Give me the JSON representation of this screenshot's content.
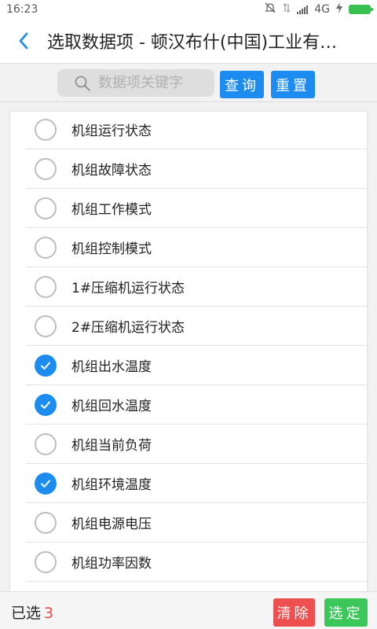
{
  "status_bar": {
    "time": "16:23",
    "network": "4G"
  },
  "header": {
    "title": "选取数据项 - 顿汉布什(中国)工业有…"
  },
  "search": {
    "placeholder": "数据项关键字",
    "query_label": "查询",
    "reset_label": "重置"
  },
  "items": [
    {
      "label": "机组运行状态",
      "checked": false
    },
    {
      "label": "机组故障状态",
      "checked": false
    },
    {
      "label": "机组工作模式",
      "checked": false
    },
    {
      "label": "机组控制模式",
      "checked": false
    },
    {
      "label": "1#压缩机运行状态",
      "checked": false
    },
    {
      "label": "2#压缩机运行状态",
      "checked": false
    },
    {
      "label": "机组出水温度",
      "checked": true
    },
    {
      "label": "机组回水温度",
      "checked": true
    },
    {
      "label": "机组当前负荷",
      "checked": false
    },
    {
      "label": "机组环境温度",
      "checked": true
    },
    {
      "label": "机组电源电压",
      "checked": false
    },
    {
      "label": "机组功率因数",
      "checked": false
    }
  ],
  "footer": {
    "selected_label": "已选",
    "selected_count": "3",
    "clear_label": "清除",
    "confirm_label": "选定"
  },
  "colors": {
    "accent": "#1d8cf0",
    "danger": "#ee4f4f",
    "success": "#3cc75a"
  }
}
